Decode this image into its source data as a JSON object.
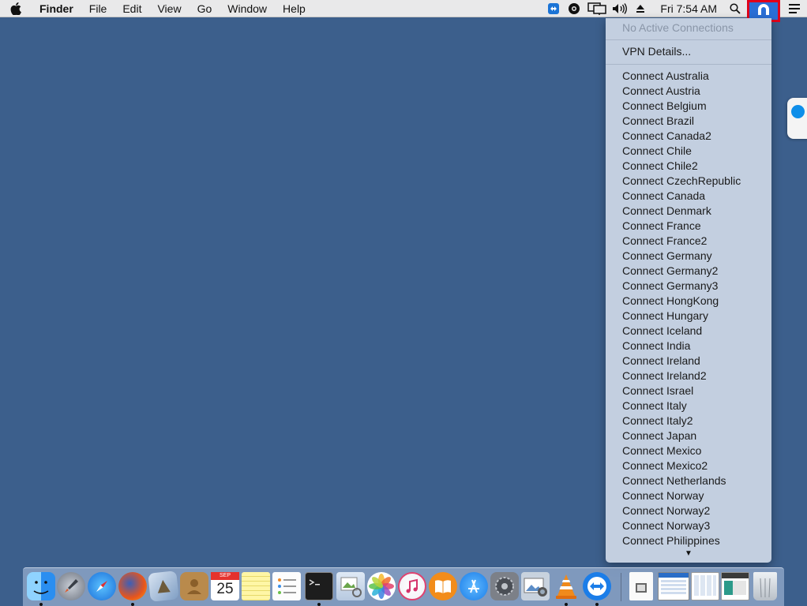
{
  "menubar": {
    "app_name": "Finder",
    "menus": [
      "File",
      "Edit",
      "View",
      "Go",
      "Window",
      "Help"
    ],
    "clock": "Fri 7:54 AM",
    "status_icons": [
      "teamviewer-icon",
      "gear-icon",
      "display-mirroring-icon",
      "volume-icon",
      "eject-icon",
      "search-icon",
      "vpn-icon",
      "notification-center-icon"
    ]
  },
  "vpn_menu": {
    "status": "No Active Connections",
    "details_label": "VPN Details...",
    "connections": [
      "Connect Australia",
      "Connect Austria",
      "Connect Belgium",
      "Connect Brazil",
      "Connect Canada2",
      "Connect Chile",
      "Connect Chile2",
      "Connect CzechRepublic",
      "Connect Canada",
      "Connect Denmark",
      "Connect France",
      "Connect France2",
      "Connect Germany",
      "Connect Germany2",
      "Connect Germany3",
      "Connect HongKong",
      "Connect Hungary",
      "Connect Iceland",
      "Connect India",
      "Connect Ireland",
      "Connect Ireland2",
      "Connect Israel",
      "Connect Italy",
      "Connect Italy2",
      "Connect Japan",
      "Connect Mexico",
      "Connect Mexico2",
      "Connect Netherlands",
      "Connect Norway",
      "Connect Norway2",
      "Connect Norway3",
      "Connect Philippines"
    ],
    "scroll_indicator": "▼"
  },
  "dock": {
    "calendar_month": "SEP",
    "calendar_day": "25",
    "apps": [
      "finder",
      "launchpad",
      "safari",
      "firefox",
      "mail",
      "contacts",
      "calendar",
      "notes",
      "reminders",
      "terminal",
      "preview",
      "photos",
      "itunes",
      "ibooks",
      "app-store",
      "system-preferences",
      "image-capture",
      "vlc",
      "teamviewer"
    ],
    "right_items": [
      "document",
      "window-thumbnail-1",
      "window-thumbnail-2",
      "window-thumbnail-3",
      "trash"
    ]
  },
  "colors": {
    "desktop": "#3c5f8c",
    "menu_bg": "#c3cfe0",
    "highlight_box": "#e0001b",
    "vpn_icon_bg": "#2b6fd6"
  }
}
